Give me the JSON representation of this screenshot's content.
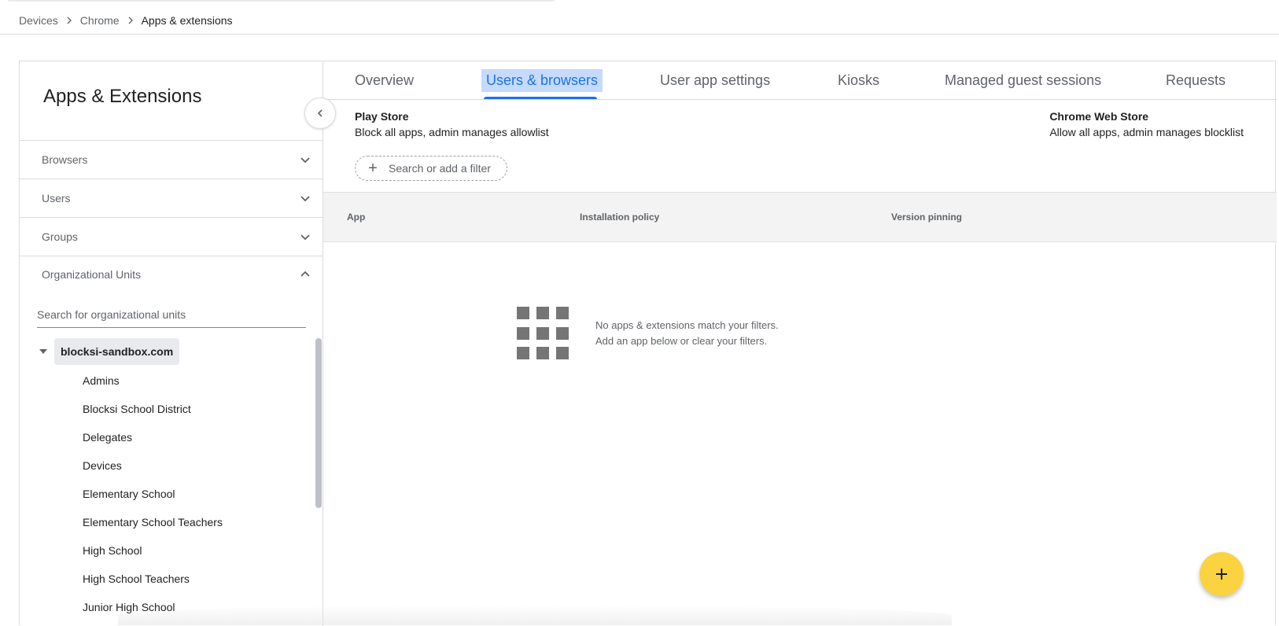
{
  "breadcrumb": {
    "items": [
      {
        "label": "Devices"
      },
      {
        "label": "Chrome"
      },
      {
        "label": "Apps & extensions"
      }
    ]
  },
  "sidebar": {
    "title": "Apps & Extensions",
    "sections": [
      {
        "label": "Browsers",
        "expanded": false
      },
      {
        "label": "Users",
        "expanded": false
      },
      {
        "label": "Groups",
        "expanded": false
      },
      {
        "label": "Organizational Units",
        "expanded": true
      }
    ],
    "ou_search": {
      "placeholder": "Search for organizational units"
    },
    "tree": {
      "root": "blocksi-sandbox.com",
      "children": [
        "Admins",
        "Blocksi School District",
        "Delegates",
        "Devices",
        "Elementary School",
        "Elementary School Teachers",
        "High School",
        "High School Teachers",
        "Junior High School"
      ]
    }
  },
  "tabs": [
    {
      "label": "Overview"
    },
    {
      "label": "Users & browsers",
      "active": true
    },
    {
      "label": "User app settings"
    },
    {
      "label": "Kiosks"
    },
    {
      "label": "Managed guest sessions"
    },
    {
      "label": "Requests"
    }
  ],
  "stores": {
    "play": {
      "title": "Play Store",
      "policy": "Block all apps, admin manages allowlist"
    },
    "chrome": {
      "title": "Chrome Web Store",
      "policy": "Allow all apps, admin manages blocklist"
    }
  },
  "filter": {
    "label": "Search or add a filter"
  },
  "table": {
    "columns": [
      "App",
      "Installation policy",
      "Version pinning"
    ]
  },
  "empty": {
    "line1": "No apps & extensions match your filters.",
    "line2": "Add an app below or clear your filters."
  },
  "icons": {
    "fab": "plus-icon",
    "collapse": "chevron-left-icon",
    "empty": "apps-grid-icon"
  },
  "colors": {
    "accent": "#1a73e8",
    "active_tab_bg": "#c6dafc",
    "fab": "#fbd340"
  }
}
